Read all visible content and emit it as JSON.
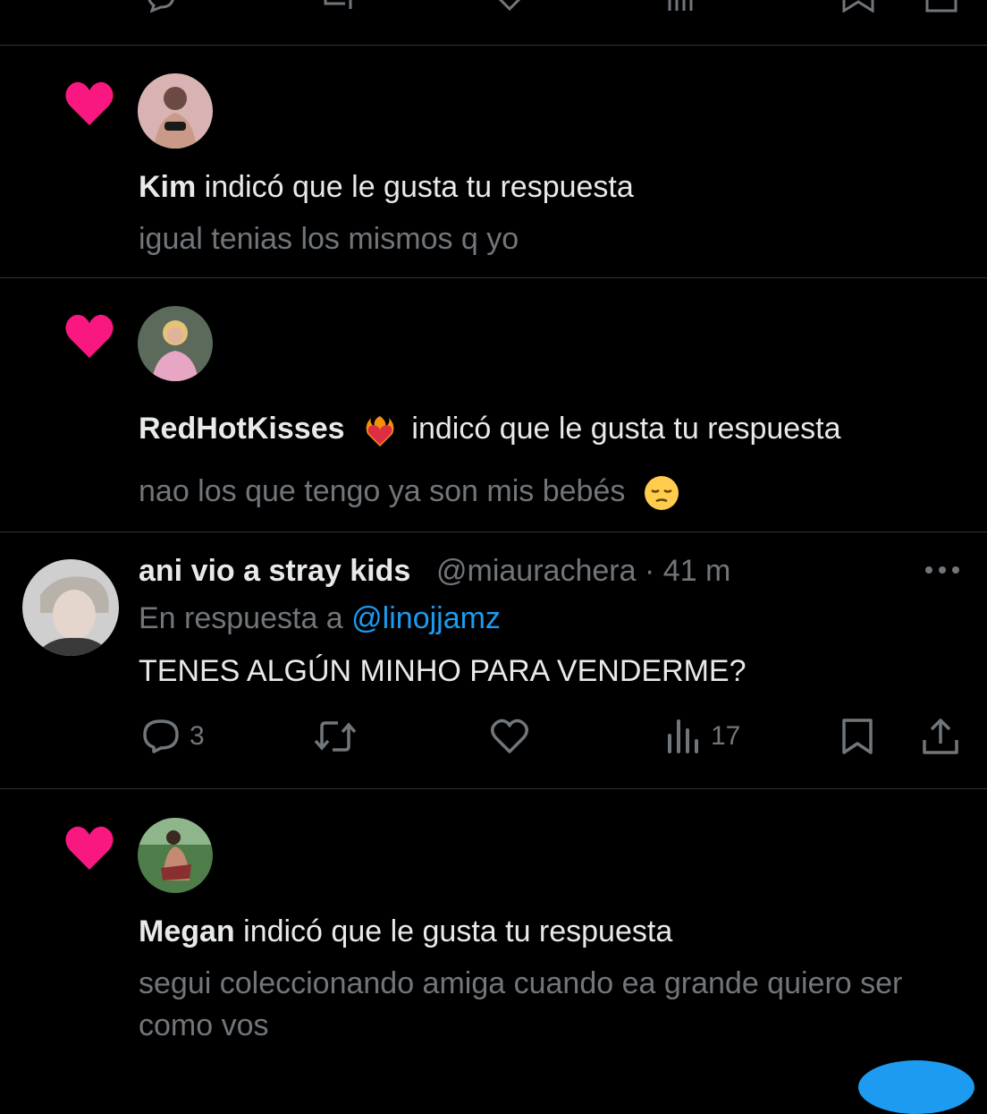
{
  "notifications": [
    {
      "user": "Kim",
      "action": " indicó que le gusta tu respuesta",
      "snippet": "igual tenias los mismos q yo",
      "avatar_colors": [
        "#d9b3b3",
        "#6b4a44"
      ]
    },
    {
      "user": "RedHotKisses",
      "user_emoji": "heart-on-fire-icon",
      "action": " indicó que le gusta tu respuesta",
      "snippet": "nao los que tengo ya son mis bebés",
      "snippet_emoji": "pensive-face-icon",
      "avatar_colors": [
        "#e7a6c4",
        "#5b6a5a"
      ]
    },
    {
      "user": "Megan",
      "action": " indicó que le gusta tu respuesta",
      "snippet": "segui coleccionando amiga cuando ea grande quiero ser como vos",
      "avatar_colors": [
        "#4f7d4a",
        "#c48a73"
      ]
    }
  ],
  "tweet": {
    "display_name": "ani vio a stray kids",
    "handle": "@miaurachera",
    "separator": " · ",
    "time": "41 m",
    "replying_prefix": "En respuesta a ",
    "replying_to": "@linojjamz",
    "text": "TENES ALGÚN MINHO PARA VENDERME?",
    "reply_count": "3",
    "retweet_count": "",
    "like_count": "",
    "view_count": "17"
  },
  "icons": {
    "heart": "heart-filled-icon",
    "reply": "reply-bubble-icon",
    "retweet": "retweet-icon",
    "like": "heart-outline-icon",
    "views": "views-bar-icon",
    "bookmark": "bookmark-icon",
    "share": "share-icon",
    "more": "more-dots-icon"
  },
  "colors": {
    "background": "#000000",
    "heart": "#f91880",
    "secondary_text": "#71767b",
    "mention": "#1d9bf0",
    "divider": "#2f3336"
  }
}
